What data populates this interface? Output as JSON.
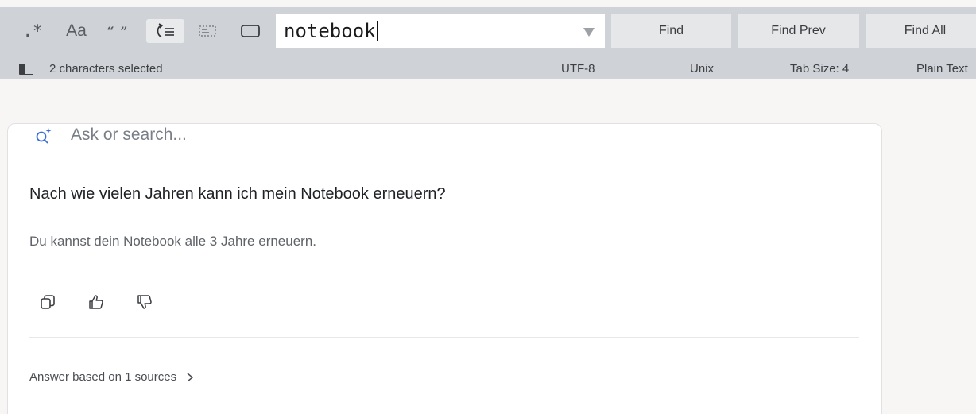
{
  "findbar": {
    "options": {
      "regex_label": ".*",
      "case_label": "Aa",
      "whole_word_label": "“ ”",
      "wrap_icon": "wrap-icon",
      "in_selection_icon": "in-selection-icon",
      "highlight_icon": "highlight-matches-icon"
    },
    "query": "notebook",
    "buttons": {
      "find": "Find",
      "find_prev": "Find Prev",
      "find_all": "Find All"
    }
  },
  "status_bar": {
    "selection": "2 characters selected",
    "encoding": "UTF-8",
    "line_endings": "Unix",
    "tab_size": "Tab Size: 4",
    "syntax": "Plain Text"
  },
  "chat": {
    "search_placeholder": "Ask or search...",
    "question": "Nach wie vielen Jahren kann ich mein Notebook erneuern?",
    "answer": "Du kannst dein Notebook alle 3 Jahre erneuern.",
    "sources_label": "Answer based on 1 sources"
  },
  "colors": {
    "findbar_bg": "#cfd2d6",
    "button_bg": "#e6e7e9",
    "accent_icon": "#3b6fd4",
    "page_bg": "#f7f6f5"
  }
}
